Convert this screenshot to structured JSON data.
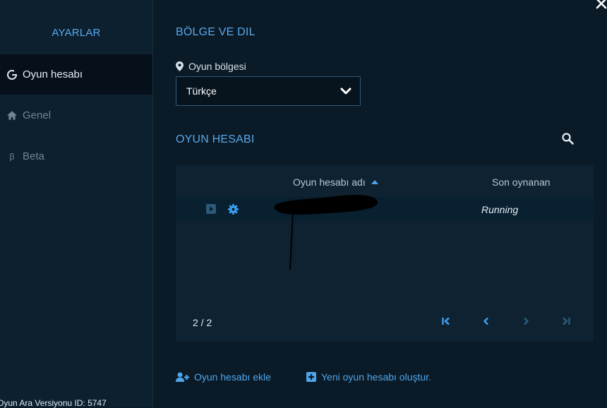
{
  "sidebar": {
    "title": "AYARLAR",
    "items": [
      {
        "label": "Oyun hesabı",
        "icon": "g-logo-icon",
        "active": true
      },
      {
        "label": "Genel",
        "icon": "home-icon",
        "active": false
      },
      {
        "label": "Beta",
        "icon": "beta-icon",
        "active": false
      }
    ],
    "footer": "Oyun Ara Versiyonu ID: 5747"
  },
  "region": {
    "heading": "BÖLGE VE DIL",
    "label": "Oyun bölgesi",
    "selected": "Türkçe"
  },
  "accounts": {
    "heading": "OYUN HESABI",
    "columns": {
      "name": "Oyun hesabı adı",
      "last_played": "Son oynanan"
    },
    "rows": [
      {
        "name": "",
        "last_played": "Running"
      }
    ],
    "page_indicator": "2 / 2"
  },
  "actions": {
    "add_account": "Oyun hesabı ekle",
    "create_account": "Yeni oyun hesabı oluştur."
  },
  "colors": {
    "accent": "#58a8ec",
    "link": "#4ea6ec",
    "background": "#0a1a26",
    "sidebar": "#0d2030",
    "table": "#0f2231"
  }
}
